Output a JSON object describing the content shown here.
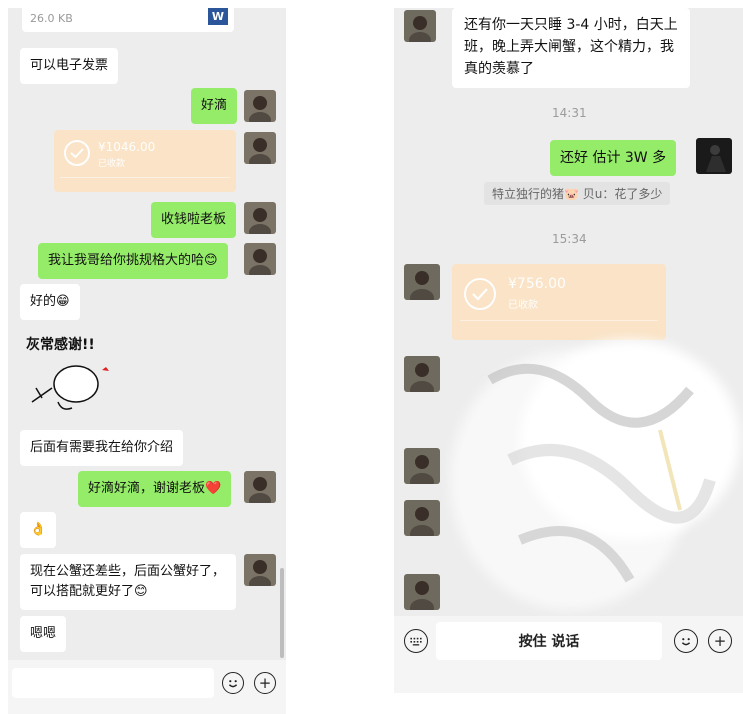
{
  "left_chat": {
    "file_size": "26.0 KB",
    "file_icon_letter": "W",
    "messages": [
      {
        "side": "recv",
        "text": "可以电子发票"
      },
      {
        "side": "sent",
        "text": "好滴"
      },
      {
        "side": "sent",
        "text": "收钱啦老板"
      },
      {
        "side": "sent",
        "text": "我让我哥给你挑规格大的哈😊"
      },
      {
        "side": "recv",
        "text": "好的😁"
      },
      {
        "side": "recv",
        "text": "后面有需要我在给你介绍"
      },
      {
        "side": "sent",
        "text": "好滴好滴，谢谢老板❤️"
      },
      {
        "side": "recv",
        "text": "👌"
      },
      {
        "side": "recv",
        "text": "现在公蟹还差些，后面公蟹好了，可以搭配就更好了😊"
      },
      {
        "side": "recv",
        "text": "嗯嗯"
      }
    ],
    "transfer": {
      "amount": "¥1046.00",
      "status": "已收款"
    },
    "sticker_text": "灰常感谢!!",
    "colors": {
      "sent": "#95ec69",
      "received": "#ffffff",
      "transfer": "#fbe3c4"
    }
  },
  "right_chat": {
    "top_message": "还有你一天只睡 3-4 小时，白天上班，晚上弄大闸蟹，这个精力，我真的羡慕了",
    "time_1": "14:31",
    "sent_message": "还好 估计 3W 多",
    "quote": "特立独行的猪🐷 贝u：花了多少",
    "time_2": "15:34",
    "transfer": {
      "amount": "¥756.00",
      "status": "已收款"
    },
    "hold_to_talk": "按住 说话"
  },
  "icons": {
    "emoji_button": "smiley-face-icon",
    "plus_button": "plus-circle-icon",
    "keyboard_button": "keyboard-icon",
    "check": "check-circle-icon"
  }
}
